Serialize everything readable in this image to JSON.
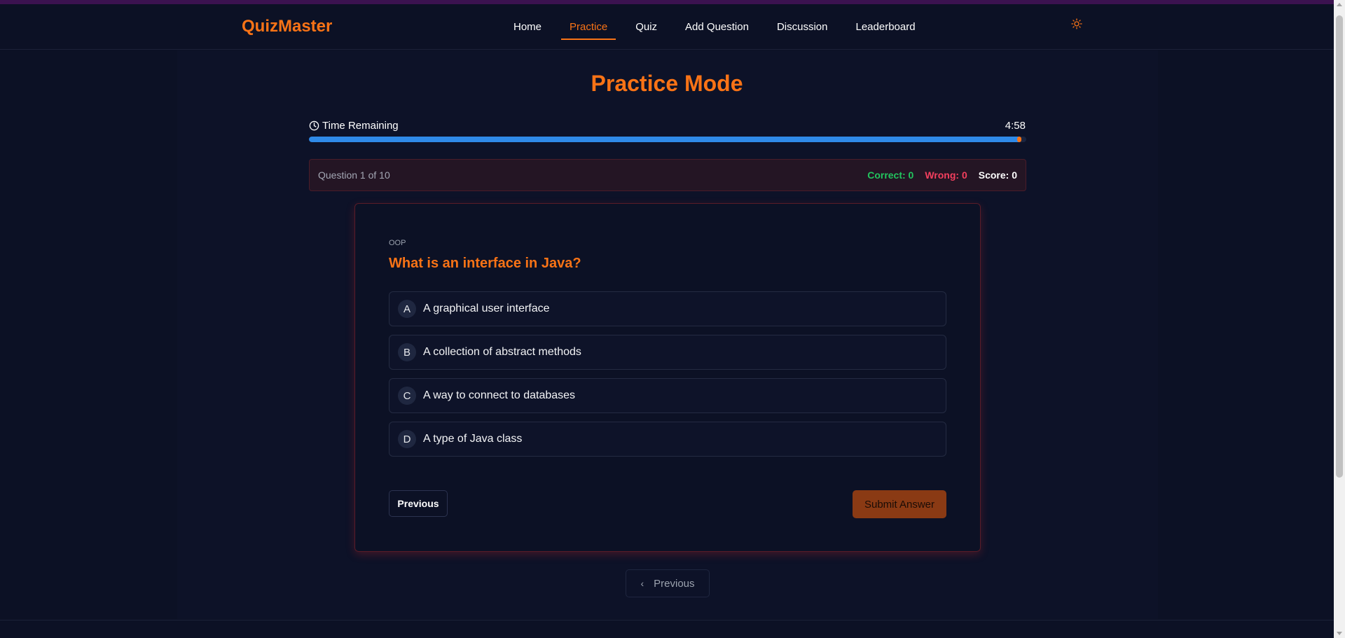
{
  "app": {
    "logo": "QuizMaster"
  },
  "nav": {
    "items": [
      {
        "label": "Home",
        "active": false
      },
      {
        "label": "Practice",
        "active": true
      },
      {
        "label": "Quiz",
        "active": false
      },
      {
        "label": "Add Question",
        "active": false
      },
      {
        "label": "Discussion",
        "active": false
      },
      {
        "label": "Leaderboard",
        "active": false
      }
    ],
    "theme_icon": "sun-icon"
  },
  "page": {
    "title": "Practice Mode"
  },
  "timer": {
    "label": "Time Remaining",
    "value": "4:58",
    "remaining_fraction": 0.993
  },
  "stats": {
    "progress": "Question 1 of 10",
    "correct": "Correct: 0",
    "wrong": "Wrong: 0",
    "score": "Score: 0"
  },
  "question": {
    "category": "OOP",
    "text": "What is an interface in Java?",
    "options": [
      {
        "letter": "A",
        "text": "A graphical user interface"
      },
      {
        "letter": "B",
        "text": "A collection of abstract methods"
      },
      {
        "letter": "C",
        "text": "A way to connect to databases"
      },
      {
        "letter": "D",
        "text": "A type of Java class"
      }
    ],
    "previous_label": "Previous",
    "submit_label": "Submit Answer"
  },
  "pager": {
    "previous_label": "Previous"
  },
  "colors": {
    "accent": "#f97316",
    "progress": "#2f8ae8",
    "correct": "#22c55e",
    "wrong": "#f43f5e",
    "background": "#0c1125"
  }
}
